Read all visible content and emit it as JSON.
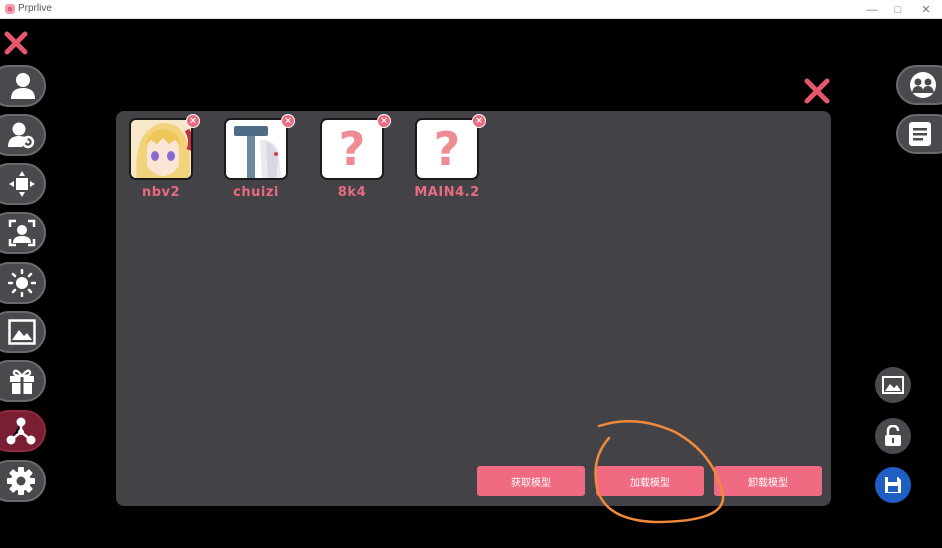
{
  "window": {
    "title": "Prprlive",
    "controls": {
      "minimize": "—",
      "maximize": "□",
      "close": "✕"
    }
  },
  "colors": {
    "accent": "#f06a82",
    "panel": "#424247",
    "sidebar_button": "#4a4a4e",
    "active_button": "#7a1e33",
    "save_button": "#1f5fc4"
  },
  "sidebar": {
    "items": [
      {
        "icon": "user-icon"
      },
      {
        "icon": "user-settings-icon"
      },
      {
        "icon": "move-icon"
      },
      {
        "icon": "face-tracking-icon"
      },
      {
        "icon": "brightness-icon"
      },
      {
        "icon": "image-icon"
      },
      {
        "icon": "gift-icon"
      },
      {
        "icon": "share-nodes-icon",
        "active": true
      },
      {
        "icon": "gear-icon"
      }
    ]
  },
  "models": [
    {
      "name": "nbv2",
      "thumbnail": "anime-girl-blonde"
    },
    {
      "name": "chuizi",
      "thumbnail": "hammer-character"
    },
    {
      "name": "8k4",
      "thumbnail": "?"
    },
    {
      "name": "MAIN4.2",
      "thumbnail": "?"
    }
  ],
  "actions": {
    "get_model": "获取模型",
    "load_model": "加载模型",
    "unload_model": "卸载模型"
  },
  "right_buttons": [
    {
      "icon": "group-icon"
    },
    {
      "icon": "list-icon"
    }
  ],
  "tools": [
    {
      "icon": "image-add-icon"
    },
    {
      "icon": "unlock-icon"
    },
    {
      "icon": "save-icon"
    }
  ]
}
